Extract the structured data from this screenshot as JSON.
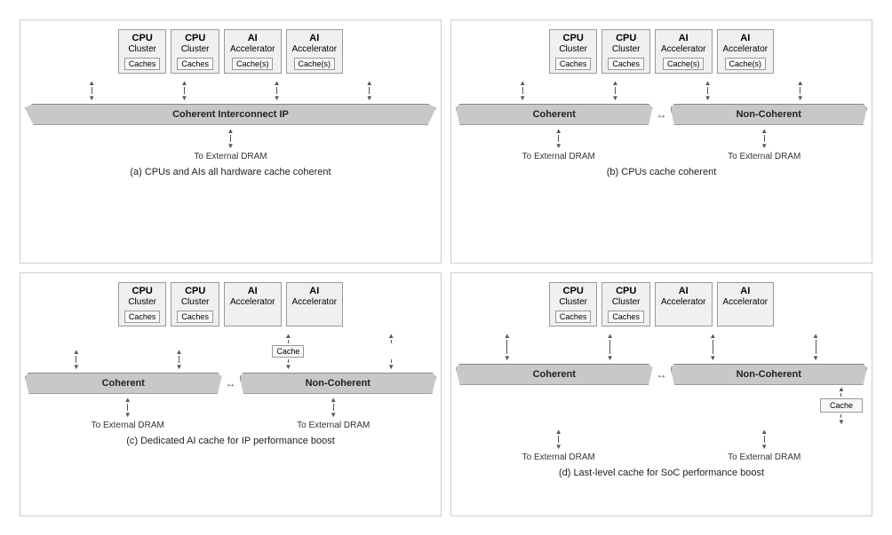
{
  "diagrams": {
    "a": {
      "title": "(a) CPUs and AIs all hardware cache coherent",
      "units": [
        {
          "line1": "CPU",
          "line2": "Cluster",
          "cache": "Caches"
        },
        {
          "line1": "CPU",
          "line2": "Cluster",
          "cache": "Caches"
        },
        {
          "line1": "AI",
          "line2": "Accelerator",
          "cache": "Cache(s)"
        },
        {
          "line1": "AI",
          "line2": "Accelerator",
          "cache": "Cache(s)"
        }
      ],
      "banner": "Coherent Interconnect IP",
      "dram": [
        "To External DRAM"
      ]
    },
    "b": {
      "title": "(b) CPUs cache coherent",
      "units": [
        {
          "line1": "CPU",
          "line2": "Cluster",
          "cache": "Caches"
        },
        {
          "line1": "CPU",
          "line2": "Cluster",
          "cache": "Caches"
        },
        {
          "line1": "AI",
          "line2": "Accelerator",
          "cache": "Cache(s)"
        },
        {
          "line1": "AI",
          "line2": "Accelerator",
          "cache": "Cache(s)"
        }
      ],
      "banner_left": "Coherent",
      "banner_right": "Non-Coherent",
      "dram_left": "To External DRAM",
      "dram_right": "To External DRAM"
    },
    "c": {
      "title": "(c) Dedicated AI cache for IP performance boost",
      "units": [
        {
          "line1": "CPU",
          "line2": "Cluster",
          "cache": "Caches"
        },
        {
          "line1": "CPU",
          "line2": "Cluster",
          "cache": "Caches"
        },
        {
          "line1": "AI",
          "line2": "Accelerator",
          "cache": null
        },
        {
          "line1": "AI",
          "line2": "Accelerator",
          "cache": null
        }
      ],
      "ai_cache_label": "Cache",
      "banner_left": "Coherent",
      "banner_right": "Non-Coherent",
      "dram_left": "To External DRAM",
      "dram_right": "To External DRAM"
    },
    "d": {
      "title": "(d) Last-level cache for SoC performance boost",
      "units": [
        {
          "line1": "CPU",
          "line2": "Cluster",
          "cache": "Caches"
        },
        {
          "line1": "CPU",
          "line2": "Cluster",
          "cache": "Caches"
        },
        {
          "line1": "AI",
          "line2": "Accelerator",
          "cache": null
        },
        {
          "line1": "AI",
          "line2": "Accelerator",
          "cache": null
        }
      ],
      "llc_label": "Cache",
      "banner_left": "Coherent",
      "banner_right": "Non-Coherent",
      "dram_left": "To External DRAM",
      "dram_right": "To External DRAM"
    }
  }
}
